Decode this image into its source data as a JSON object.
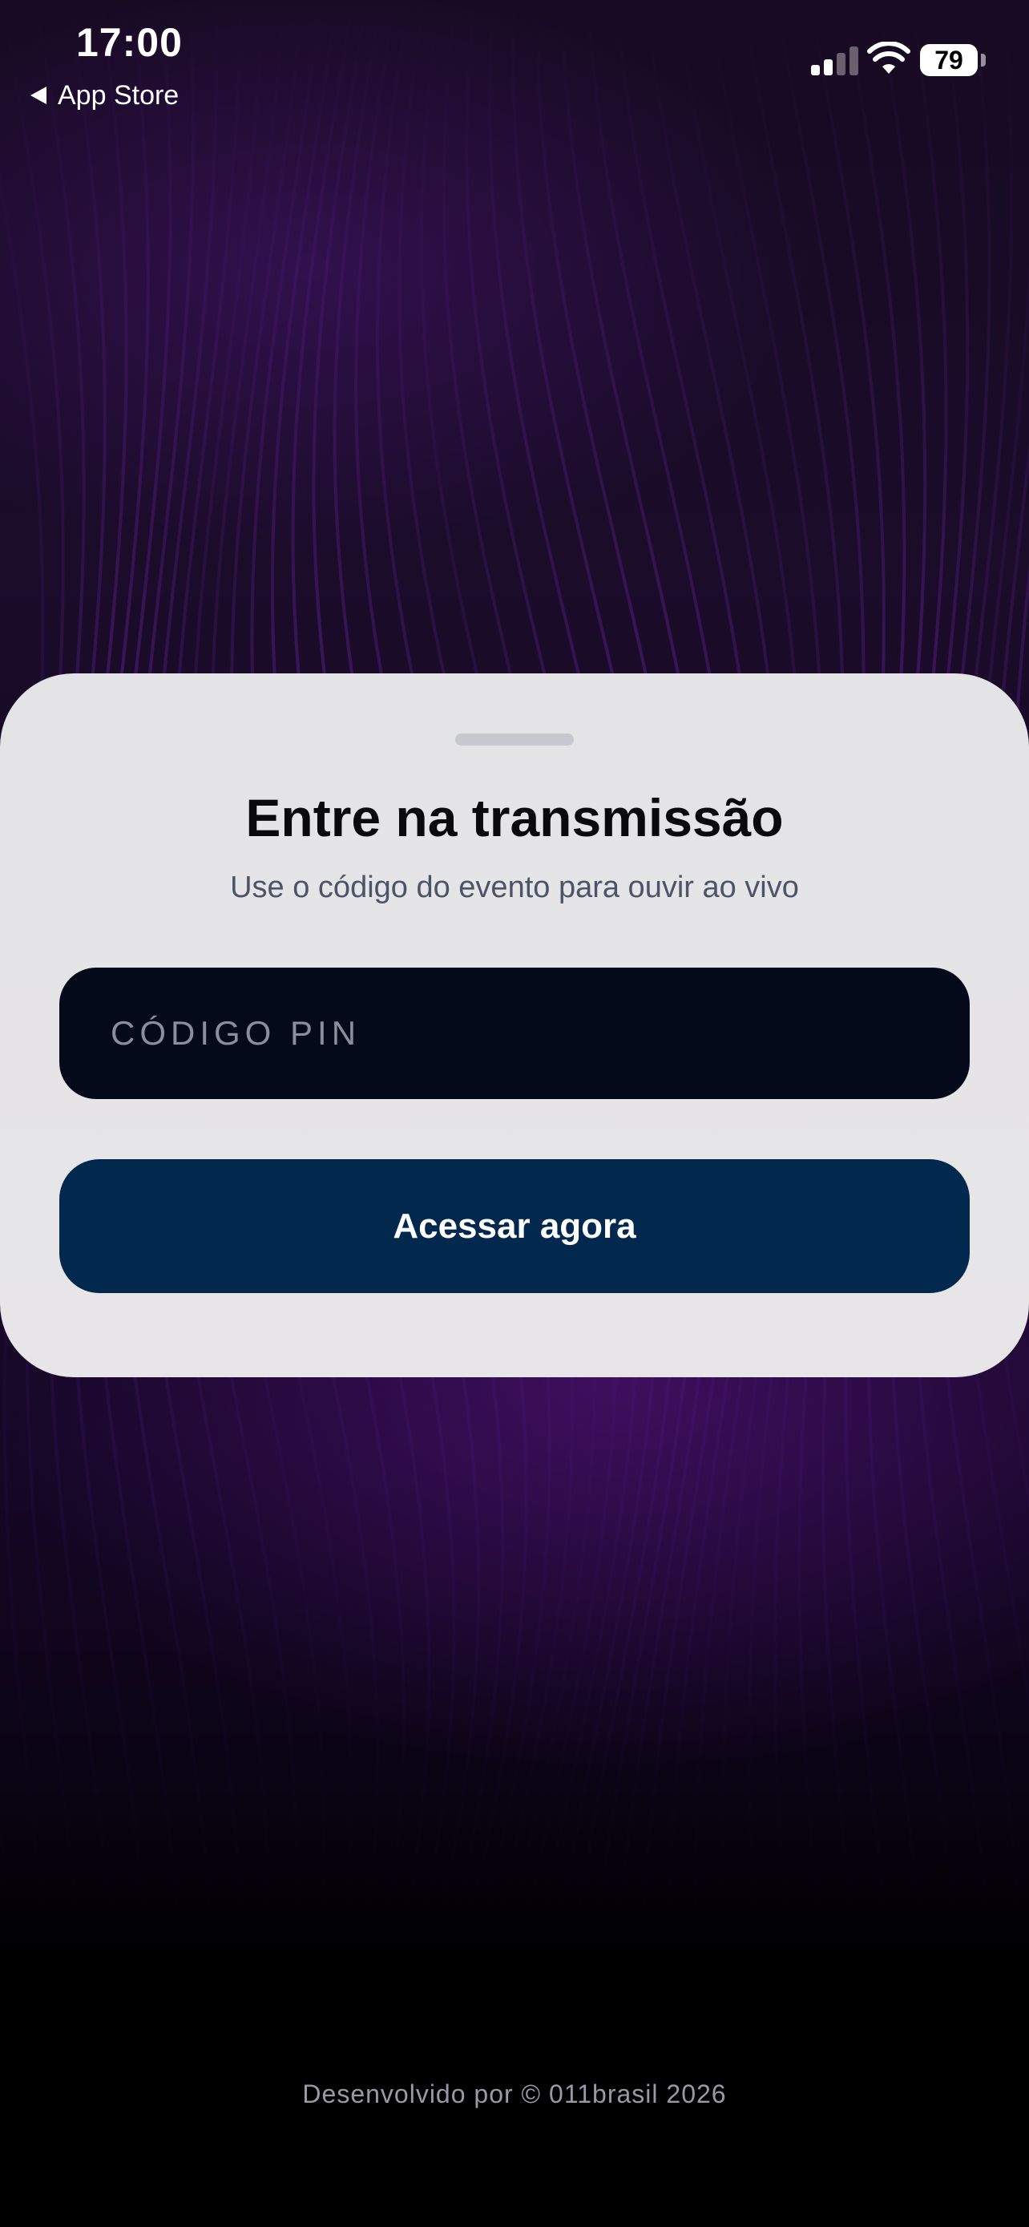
{
  "status_bar": {
    "time": "17:00",
    "back_label": "App Store",
    "battery_level": "79"
  },
  "sheet": {
    "title": "Entre na transmissão",
    "subtitle": "Use o código do evento para ouvir ao vivo",
    "pin_input": {
      "placeholder": "CÓDIGO PIN",
      "value": ""
    },
    "access_button_label": "Acessar agora"
  },
  "footer": {
    "credit": "Desenvolvido por © 011brasil 2026"
  },
  "colors": {
    "sheet_background": "#e4e4e6",
    "input_background": "#040a1a",
    "button_background": "#02284d",
    "background_accent": "#5a1a8c"
  }
}
